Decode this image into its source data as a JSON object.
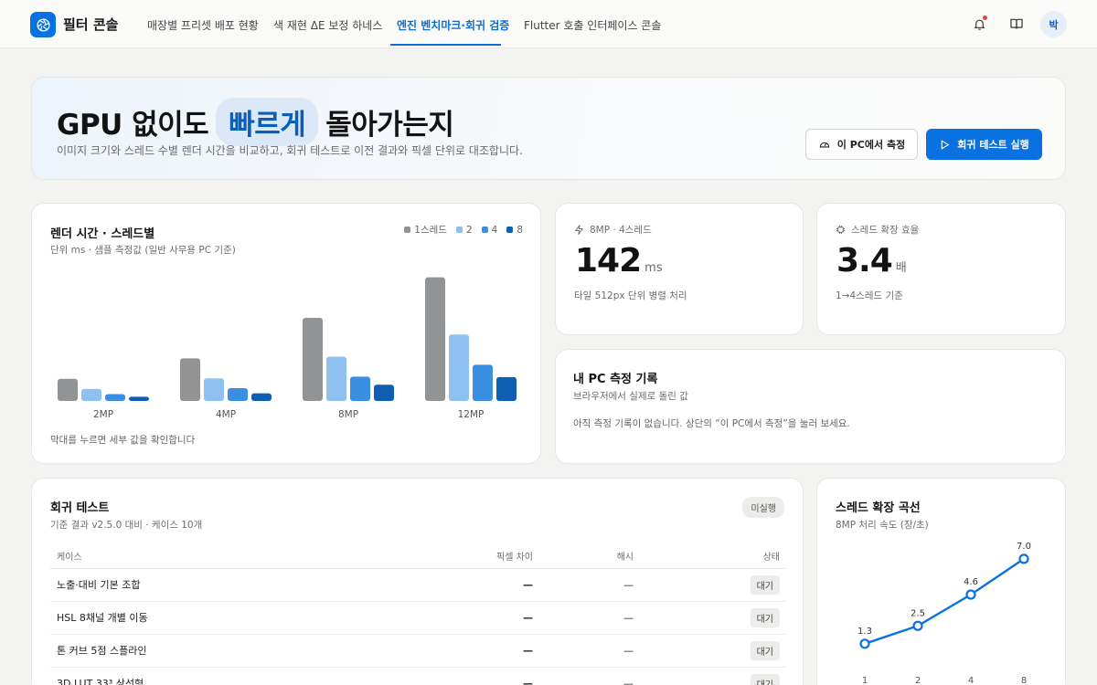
{
  "app": {
    "brand": "필터 콘솔",
    "avatar_initial": "박"
  },
  "nav": {
    "tabs": [
      {
        "label": "매장별 프리셋 배포 현황",
        "active": false
      },
      {
        "label": "색 재현 ΔE 보정 하네스",
        "active": false
      },
      {
        "label": "엔진 벤치마크·회귀 검증",
        "active": true
      },
      {
        "label": "Flutter 호출 인터페이스 콘솔",
        "active": false
      }
    ]
  },
  "colors": {
    "accent": "#0a72e0",
    "thread1": "#929395",
    "thread2": "#8ec1ef",
    "thread4": "#3b8fe3",
    "thread8": "#0e5fb3"
  },
  "hero": {
    "title_pre": "GPU 없이도",
    "title_highlight": "빠르게",
    "title_post": "돌아가는지",
    "subtitle": "이미지 크기와 스레드 수별 렌더 시간을 비교하고, 회귀 테스트로 이전 결과와 픽셀 단위로 대조합니다.",
    "btn_measure": "이 PC에서 측정",
    "btn_run": "회귀 테스트 실행"
  },
  "render_card": {
    "title": "렌더 시간 · 스레드별",
    "subtitle": "단위 ms · 샘플 측정값 (일반 사무용 PC 기준)",
    "footer": "막대를 누르면 세부 값을 확인합니다"
  },
  "stat_speed": {
    "label": "8MP · 4스레드",
    "value": "142",
    "unit": "ms",
    "note": "타일 512px 단위 병렬 처리"
  },
  "stat_scale": {
    "label": "스레드 확장 효율",
    "value": "3.4",
    "unit": "배",
    "note": "1→4스레드 기준"
  },
  "my_pc": {
    "title": "내 PC 측정 기록",
    "subtitle": "브라우저에서 실제로 돌린 값",
    "empty": "아직 측정 기록이 없습니다. 상단의 “이 PC에서 측정”을 눌러 보세요."
  },
  "regression": {
    "title": "회귀 테스트",
    "subtitle": "기준 결과 v2.5.0 대비 · 케이스 10개",
    "badge": "미실행",
    "columns": [
      "케이스",
      "픽셀 차이",
      "해시",
      "상태"
    ],
    "rows": [
      {
        "case": "노출·대비 기본 조합",
        "pixel": "—",
        "hash": "—",
        "status": "대기"
      },
      {
        "case": "HSL 8채널 개별 이동",
        "pixel": "—",
        "hash": "—",
        "status": "대기"
      },
      {
        "case": "톤 커브 5점 스플라인",
        "pixel": "—",
        "hash": "—",
        "status": "대기"
      },
      {
        "case": "3D LUT 33³ 삼선형",
        "pixel": "—",
        "hash": "—",
        "status": "대기"
      }
    ]
  },
  "scaling_card": {
    "title": "스레드 확장 곡선",
    "subtitle": "8MP 처리 속도 (장/초)"
  },
  "chart_data": [
    {
      "type": "bar",
      "title": "렌더 시간 · 스레드별",
      "categories": [
        "2MP",
        "4MP",
        "8MP",
        "12MP"
      ],
      "ylim": [
        0,
        300
      ],
      "legend": "top-right",
      "grid": false,
      "series": [
        {
          "name": "1스레드",
          "color": "#929395",
          "values": [
            52,
            100,
            195,
            290
          ]
        },
        {
          "name": "2",
          "color": "#8ec1ef",
          "values": [
            28,
            53,
            104,
            156
          ]
        },
        {
          "name": "4",
          "color": "#3b8fe3",
          "values": [
            16,
            30,
            57,
            85
          ]
        },
        {
          "name": "8",
          "color": "#0e5fb3",
          "values": [
            10,
            18,
            38,
            56
          ]
        }
      ]
    },
    {
      "type": "line",
      "title": "스레드 확장 곡선",
      "x": [
        "1",
        "2",
        "4",
        "8"
      ],
      "ylim": [
        0,
        8
      ],
      "grid": false,
      "series": [
        {
          "color": "#0a72e0",
          "values": [
            1.3,
            2.5,
            4.6,
            7.0
          ]
        }
      ]
    }
  ]
}
